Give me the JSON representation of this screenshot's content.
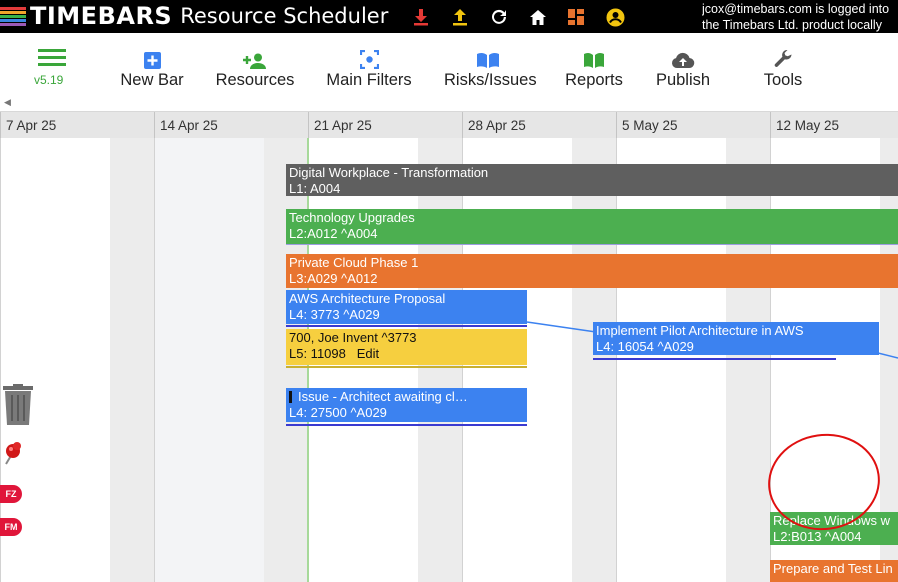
{
  "header": {
    "brand": "TIMEBARS",
    "title": "Resource Scheduler",
    "icons": [
      "download-icon",
      "upload-icon",
      "refresh-icon",
      "home-icon",
      "dashboard-icon",
      "account-icon"
    ],
    "user_line1": "jcox@timebars.com is logged into",
    "user_line2": "the Timebars Ltd. product locally"
  },
  "toolbar": {
    "version": "v5.19",
    "items": [
      {
        "label": "New Bar",
        "icon": "add-box-icon"
      },
      {
        "label": "Resources",
        "icon": "add-person-icon"
      },
      {
        "label": "Main Filters",
        "icon": "filter-center-icon"
      },
      {
        "label": "Risks/Issues",
        "icon": "book-open-icon"
      },
      {
        "label": "Reports",
        "icon": "book-icon"
      },
      {
        "label": "Publish",
        "icon": "cloud-upload-icon"
      },
      {
        "label": "Tools",
        "icon": "wrench-icon"
      }
    ]
  },
  "timeline": {
    "dates": [
      "7 Apr 25",
      "14 Apr 25",
      "21 Apr 25",
      "28 Apr 25",
      "5 May 25",
      "12 May 25"
    ]
  },
  "bars": {
    "b1": {
      "line1": "Digital Workplace - Transformation",
      "line2": "L1: A004",
      "color": "#5f5f5f"
    },
    "b2": {
      "line1": "Technology Upgrades",
      "line2": "L2:A012 ^A004",
      "color": "#4caf50"
    },
    "b3": {
      "line1": "Private Cloud Phase 1",
      "line2": "L3:A029 ^A012",
      "color": "#e8742f"
    },
    "b4": {
      "line1": "AWS Architecture Proposal",
      "line2": "L4: 3773 ^A029",
      "color": "#3c82f0"
    },
    "b5": {
      "line1": "700, Joe Invent ^3773",
      "line2": "L5: 11098",
      "edit": "Edit",
      "color": "#f6cf3f"
    },
    "b6": {
      "line1": "Issue - Architect awaiting cl…",
      "line2": "L4: 27500 ^A029",
      "color": "#3c82f0"
    },
    "b7": {
      "line1": "Implement Pilot Architecture in AWS",
      "line2": "L4: 16054 ^A029",
      "color": "#3c82f0"
    },
    "b8": {
      "line1": "Replace Windows w",
      "line2": "L2:B013 ^A004",
      "color": "#4caf50"
    },
    "b9": {
      "line1": "Prepare and Test Lin",
      "color": "#e8742f"
    }
  },
  "side": {
    "tags": [
      "FZ",
      "FM"
    ]
  }
}
